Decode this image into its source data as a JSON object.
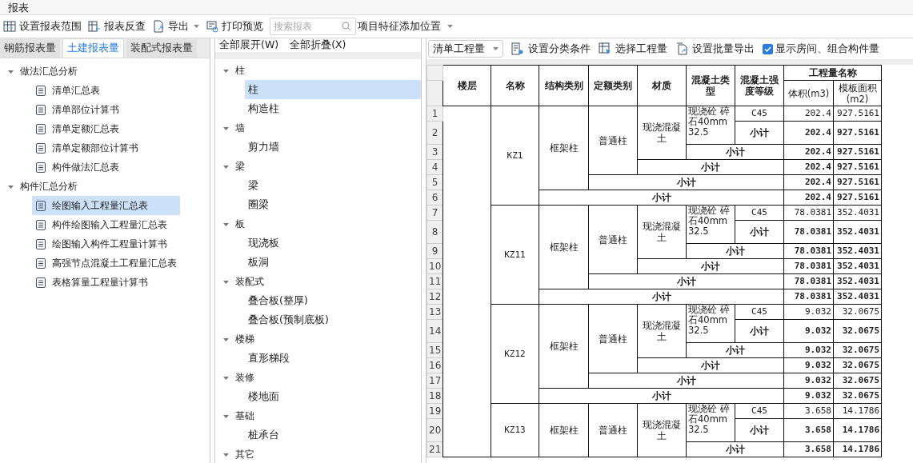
{
  "window": {
    "title": "报表"
  },
  "toolbar": {
    "buttons": [
      {
        "label": "设置报表范围",
        "dropdown": false
      },
      {
        "label": "报表反查",
        "dropdown": false
      },
      {
        "label": "导出",
        "dropdown": true
      },
      {
        "label": "打印预览",
        "dropdown": false
      }
    ],
    "search": {
      "placeholder": "搜索报表"
    },
    "position_dropdown": {
      "value": "项目特征添加位置"
    }
  },
  "left_panel": {
    "tabs": [
      {
        "label": "钢筋报表量",
        "selected": false
      },
      {
        "label": "土建报表量",
        "selected": true
      },
      {
        "label": "装配式报表量",
        "selected": false
      }
    ],
    "tree": [
      {
        "label": "做法汇总分析",
        "expanded": true,
        "children": [
          {
            "label": "清单汇总表",
            "selected": false
          },
          {
            "label": "清单部位计算书",
            "selected": false
          },
          {
            "label": "清单定额汇总表",
            "selected": false
          },
          {
            "label": "清单定额部位计算书",
            "selected": false
          },
          {
            "label": "构件做法汇总表",
            "selected": false
          }
        ]
      },
      {
        "label": "构件汇总分析",
        "expanded": true,
        "children": [
          {
            "label": "绘图输入工程量汇总表",
            "selected": true
          },
          {
            "label": "构件绘图输入工程量汇总表",
            "selected": false
          },
          {
            "label": "绘图输入构件工程量计算书",
            "selected": false
          },
          {
            "label": "高强节点混凝土工程量汇总表",
            "selected": false
          },
          {
            "label": "表格算量工程量计算书",
            "selected": false
          }
        ]
      }
    ]
  },
  "middle_panel": {
    "buttons": [
      "全部展开(W)",
      "全部折叠(X)"
    ],
    "tree": [
      {
        "label": "柱",
        "expanded": true,
        "children": [
          {
            "label": "柱",
            "selected": true
          },
          {
            "label": "构造柱",
            "selected": false
          }
        ]
      },
      {
        "label": "墙",
        "expanded": true,
        "children": [
          {
            "label": "剪力墙",
            "selected": false
          }
        ]
      },
      {
        "label": "梁",
        "expanded": true,
        "children": [
          {
            "label": "梁",
            "selected": false
          },
          {
            "label": "圈梁",
            "selected": false
          }
        ]
      },
      {
        "label": "板",
        "expanded": true,
        "children": [
          {
            "label": "现浇板",
            "selected": false
          },
          {
            "label": "板洞",
            "selected": false
          }
        ]
      },
      {
        "label": "装配式",
        "expanded": true,
        "children": [
          {
            "label": "叠合板(整厚)",
            "selected": false
          },
          {
            "label": "叠合板(预制底板)",
            "selected": false
          }
        ]
      },
      {
        "label": "楼梯",
        "expanded": true,
        "children": [
          {
            "label": "直形梯段",
            "selected": false
          }
        ]
      },
      {
        "label": "装修",
        "expanded": true,
        "children": [
          {
            "label": "楼地面",
            "selected": false
          }
        ]
      },
      {
        "label": "基础",
        "expanded": true,
        "children": [
          {
            "label": "桩承台",
            "selected": false
          }
        ]
      },
      {
        "label": "其它",
        "expanded": true
      }
    ]
  },
  "report_panel": {
    "quantity_dropdown": {
      "value": "清单工程量"
    },
    "buttons": [
      "设置分类条件",
      "选择工程量",
      "设置批量导出"
    ],
    "show_rooms": {
      "label": "显示房间、组合构件量",
      "checked": true
    },
    "table": {
      "columns": [
        "楼层",
        "名称",
        "结构类别",
        "定额类别",
        "材质",
        "混凝土类型",
        "混凝土强度等级"
      ],
      "quantity_header": "工程量名称",
      "quantity_columns": [
        "体积(m3)",
        "模板面积(m2)"
      ],
      "groups": [
        {
          "name": "KZ1",
          "structure": "框架柱",
          "quota_type": "普通柱",
          "material": "现浇混凝土",
          "concrete_type": "现浇砼 碎石40mm 32.5",
          "grade": "C45",
          "rows": [
            {
              "kind": "detail",
              "number": "1",
              "volume": "202.4",
              "area": "927.5161"
            },
            {
              "kind": "subtotal_grade",
              "number": "2",
              "label": "小计",
              "volume": "202.4",
              "area": "927.5161"
            },
            {
              "kind": "subtotal_type",
              "number": "3",
              "label": "小计",
              "volume": "202.4",
              "area": "927.5161"
            },
            {
              "kind": "subtotal_material",
              "number": "4",
              "label": "小计",
              "volume": "202.4",
              "area": "927.5161"
            },
            {
              "kind": "subtotal_quota",
              "number": "5",
              "label": "小计",
              "volume": "202.4",
              "area": "927.5161"
            },
            {
              "kind": "subtotal_structure",
              "number": "6",
              "label": "小计",
              "volume": "202.4",
              "area": "927.5161"
            }
          ]
        },
        {
          "name": "KZ11",
          "structure": "框架柱",
          "quota_type": "普通柱",
          "material": "现浇混凝土",
          "concrete_type": "现浇砼 碎石40mm 32.5",
          "grade": "C45",
          "rows": [
            {
              "kind": "detail",
              "number": "7",
              "volume": "78.0381",
              "area": "352.4031"
            },
            {
              "kind": "subtotal_grade",
              "number": "8",
              "label": "小计",
              "volume": "78.0381",
              "area": "352.4031"
            },
            {
              "kind": "subtotal_type",
              "number": "9",
              "label": "小计",
              "volume": "78.0381",
              "area": "352.4031"
            },
            {
              "kind": "subtotal_material",
              "number": "10",
              "label": "小计",
              "volume": "78.0381",
              "area": "352.4031"
            },
            {
              "kind": "subtotal_quota",
              "number": "11",
              "label": "小计",
              "volume": "78.0381",
              "area": "352.4031"
            },
            {
              "kind": "subtotal_structure",
              "number": "12",
              "label": "小计",
              "volume": "78.0381",
              "area": "352.4031"
            }
          ]
        },
        {
          "name": "KZ12",
          "structure": "框架柱",
          "quota_type": "普通柱",
          "material": "现浇混凝土",
          "concrete_type": "现浇砼 碎石40mm 32.5",
          "grade": "C45",
          "rows": [
            {
              "kind": "detail",
              "number": "13",
              "volume": "9.032",
              "area": "32.0675"
            },
            {
              "kind": "subtotal_grade",
              "number": "14",
              "label": "小计",
              "volume": "9.032",
              "area": "32.0675"
            },
            {
              "kind": "subtotal_type",
              "number": "15",
              "label": "小计",
              "volume": "9.032",
              "area": "32.0675"
            },
            {
              "kind": "subtotal_material",
              "number": "16",
              "label": "小计",
              "volume": "9.032",
              "area": "32.0675"
            },
            {
              "kind": "subtotal_quota",
              "number": "17",
              "label": "小计",
              "volume": "9.032",
              "area": "32.0675"
            },
            {
              "kind": "subtotal_structure",
              "number": "18",
              "label": "小计",
              "volume": "9.032",
              "area": "32.0675"
            }
          ]
        },
        {
          "name": "KZ13",
          "structure": "框架柱",
          "quota_type": "普通柱",
          "material": "现浇混凝土",
          "concrete_type": "现浇砼 碎石40mm 32.5",
          "grade": "C45",
          "rows": [
            {
              "kind": "detail",
              "number": "19",
              "volume": "3.658",
              "area": "14.1786"
            },
            {
              "kind": "subtotal_grade",
              "number": "20",
              "label": "小计",
              "volume": "3.658",
              "area": "14.1786"
            },
            {
              "kind": "subtotal_type",
              "number": "21",
              "label": "小计",
              "volume": "3.658",
              "area": "14.1786"
            }
          ]
        }
      ]
    }
  }
}
